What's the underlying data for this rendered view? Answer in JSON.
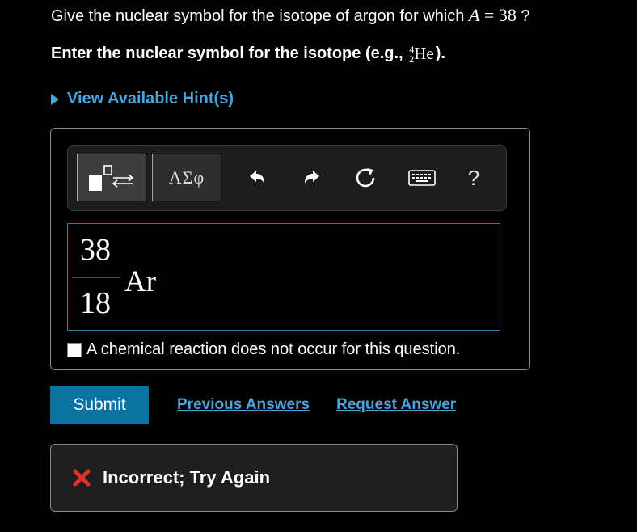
{
  "question": {
    "text": "Give the nuclear symbol for the isotope of argon for which",
    "var": "A",
    "equals": "=",
    "value": "38",
    "end": "?"
  },
  "instruction": {
    "before": "Enter the nuclear symbol for the isotope (e.g.,",
    "example_mass": "4",
    "example_atomic": "2",
    "example_symbol": "He",
    "after": ")."
  },
  "hint": {
    "label": "View Available Hint(s)"
  },
  "toolbar": {
    "symbols_label": "ΑΣφ",
    "help_label": "?"
  },
  "answer": {
    "mass_number": "38",
    "atomic_number": "18",
    "element": "Ar"
  },
  "no_reaction": {
    "label": "A chemical reaction does not occur for this question."
  },
  "actions": {
    "submit": "Submit",
    "previous_answers": "Previous Answers",
    "request_answer": "Request Answer"
  },
  "feedback": {
    "message": "Incorrect; Try Again"
  },
  "colors": {
    "accent": "#4aa3d9",
    "submit_bg": "#0b73a0",
    "error": "#e03131"
  }
}
